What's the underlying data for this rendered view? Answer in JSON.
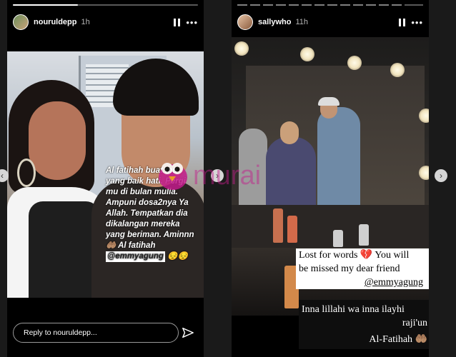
{
  "stories": [
    {
      "username": "nouruldepp",
      "time": "1h",
      "caption_lines": [
        "Al fatihah buat mu",
        "yang baik hati. Pergi",
        "mu di bulan mulia.",
        "Ampuni dosa2nya Ya",
        "Allah. Tempatkan dia",
        "dikalangan mereka",
        "yang beriman. Aminnn",
        "🤲🏽 Al fatihah"
      ],
      "mention": "@emmyagung",
      "mention_emoji": "😔😔",
      "reply_placeholder": "Reply to nouruldepp..."
    },
    {
      "username": "sallywho",
      "time": "11h",
      "caption_lines": [
        "Lost for words 💔 You will",
        "be missed my dear friend"
      ],
      "mention": "@emmyagung",
      "caption2_lines": [
        "Inna lillahi wa inna ilayhi",
        "raji'un",
        "Al-Fatihah 🤲🏽"
      ]
    }
  ],
  "watermark": "murai",
  "icons": {
    "pause": "pause-icon",
    "more": "more-icon",
    "send": "send-icon",
    "prev": "chevron-left-icon",
    "next": "chevron-right-icon"
  },
  "colors": {
    "watermark": "#c21b8b",
    "background": "#1a1a1a"
  }
}
